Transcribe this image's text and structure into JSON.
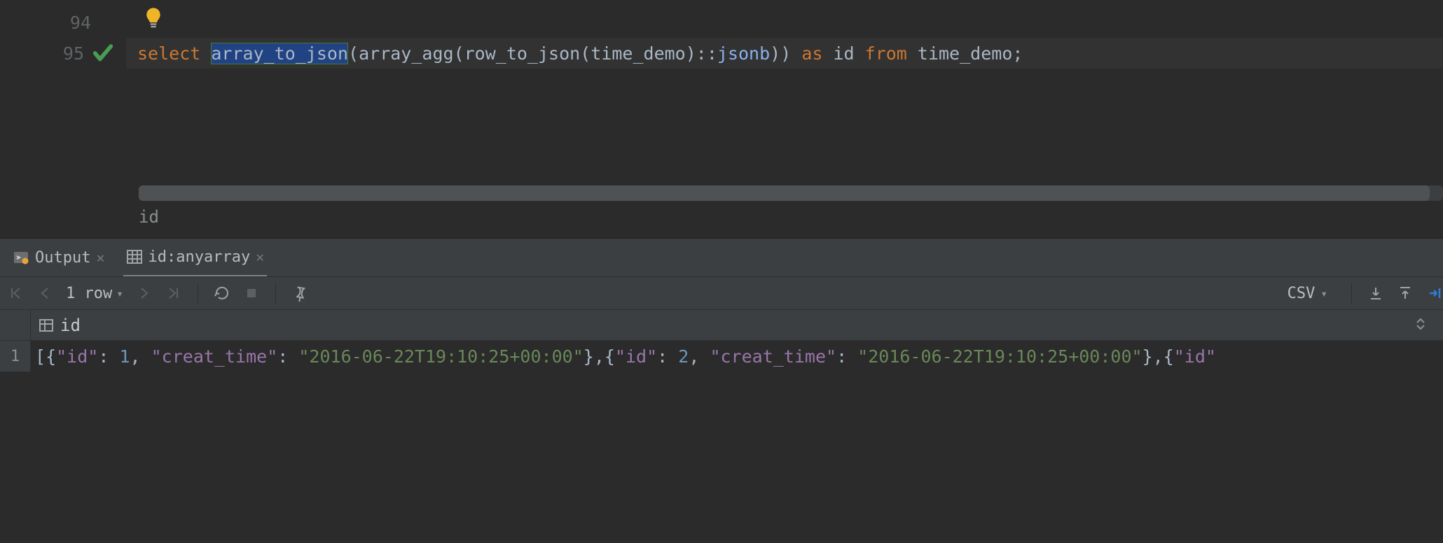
{
  "editor": {
    "lines": {
      "94": {
        "number": "94"
      },
      "95": {
        "number": "95"
      }
    },
    "tokens": {
      "select": "select ",
      "array_to_json": "array_to_json",
      "lp1": "(",
      "array_agg": "array_agg",
      "lp2": "(",
      "row_to_json": "row_to_json",
      "lp3": "(",
      "time_demo1": "time_demo",
      "rp3cc": ")::",
      "jsonb": "jsonb",
      "rp2": ")",
      "rp1": ") ",
      "as": "as ",
      "id": "id ",
      "from": "from ",
      "time_demo2": "time_demo",
      "semi": ";"
    },
    "hint": "id"
  },
  "tabs": {
    "output": {
      "label": "Output"
    },
    "result": {
      "label": "id:anyarray"
    }
  },
  "toolbar": {
    "rowcount": "1 row",
    "export_format": "CSV"
  },
  "results": {
    "column_header": "id",
    "row_number": "1",
    "cell": {
      "lb": "[",
      "lc1": "{",
      "k_id": "\"id\"",
      "colon": ": ",
      "v1": "1",
      "comma": ", ",
      "k_ct": "\"creat_time\"",
      "v_ct": "\"2016-06-22T19:10:25+00:00\"",
      "rc": "}",
      "commasep": ",",
      "lc2": "{",
      "v2": "2",
      "tail_k": "\"id\""
    }
  }
}
